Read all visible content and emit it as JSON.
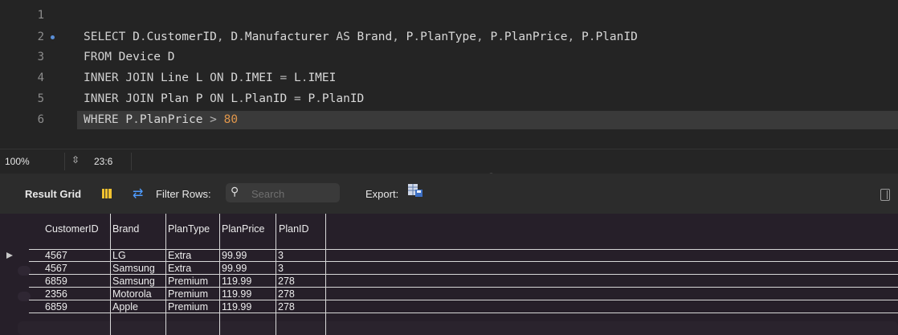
{
  "editor": {
    "lines": [
      {
        "n": "1",
        "text": ""
      },
      {
        "n": "2",
        "text": "SELECT D.CustomerID, D.Manufacturer AS Brand, P.PlanType, P.PlanPrice, P.PlanID"
      },
      {
        "n": "3",
        "text": "FROM Device D"
      },
      {
        "n": "4",
        "text": "INNER JOIN Line L ON D.IMEI = L.IMEI"
      },
      {
        "n": "5",
        "text": "INNER JOIN Plan P ON L.PlanID = P.PlanID"
      },
      {
        "n": "6",
        "text": "WHERE P.PlanPrice > 80"
      }
    ],
    "current_line": 6
  },
  "status": {
    "zoom": "100%",
    "cursor": "23:6"
  },
  "result_toolbar": {
    "title": "Result Grid",
    "filter_label": "Filter Rows:",
    "search_placeholder": "Search",
    "export_label": "Export:"
  },
  "grid": {
    "columns": [
      "CustomerID",
      "Brand",
      "PlanType",
      "PlanPrice",
      "PlanID"
    ],
    "rows": [
      [
        "4567",
        "LG",
        "Extra",
        "99.99",
        "3"
      ],
      [
        "4567",
        "Samsung",
        "Extra",
        "99.99",
        "3"
      ],
      [
        "6859",
        "Samsung",
        "Premium",
        "119.99",
        "278"
      ],
      [
        "2356",
        "Motorola",
        "Premium",
        "119.99",
        "278"
      ],
      [
        "6859",
        "Apple",
        "Premium",
        "119.99",
        "278"
      ]
    ]
  },
  "colors": {
    "keyword": "#cfcfcf",
    "number": "#e0964b",
    "accent": "#4e9cff"
  }
}
